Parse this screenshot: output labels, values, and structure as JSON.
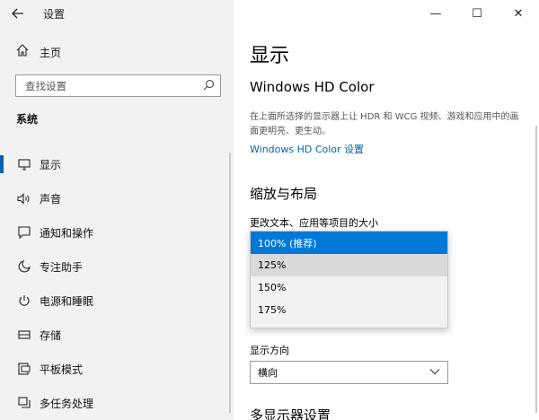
{
  "window": {
    "title": "设置",
    "back_icon": "arrow-left-icon",
    "controls": {
      "minimize": "—",
      "maximize": "☐",
      "close": "✕"
    }
  },
  "sidebar": {
    "home_label": "主页",
    "search_placeholder": "查找设置",
    "section_title": "系统",
    "items": [
      {
        "label": "显示",
        "icon": "monitor-icon",
        "active": true
      },
      {
        "label": "声音",
        "icon": "speaker-icon"
      },
      {
        "label": "通知和操作",
        "icon": "notification-icon"
      },
      {
        "label": "专注助手",
        "icon": "moon-icon"
      },
      {
        "label": "电源和睡眠",
        "icon": "power-icon"
      },
      {
        "label": "存储",
        "icon": "storage-icon"
      },
      {
        "label": "平板模式",
        "icon": "tablet-icon"
      },
      {
        "label": "多任务处理",
        "icon": "multitask-icon"
      }
    ]
  },
  "main": {
    "title": "显示",
    "hdr_title": "Windows HD Color",
    "hdr_desc": "在上面所选择的显示器上让 HDR 和 WCG 视频、游戏和应用中的画面更明亮、更生动。",
    "hdr_link": "Windows HD Color 设置",
    "scale_heading": "缩放与布局",
    "scale_label": "更改文本、应用等项目的大小",
    "scale_options": [
      "100% (推荐)",
      "125%",
      "150%",
      "175%"
    ],
    "orientation_label": "显示方向",
    "orientation_value": "横向",
    "next_heading": "多显示器设置"
  },
  "colors": {
    "accent": "#0078d7",
    "link": "#0063b1",
    "sidebar_bg": "#f2f2f2"
  }
}
